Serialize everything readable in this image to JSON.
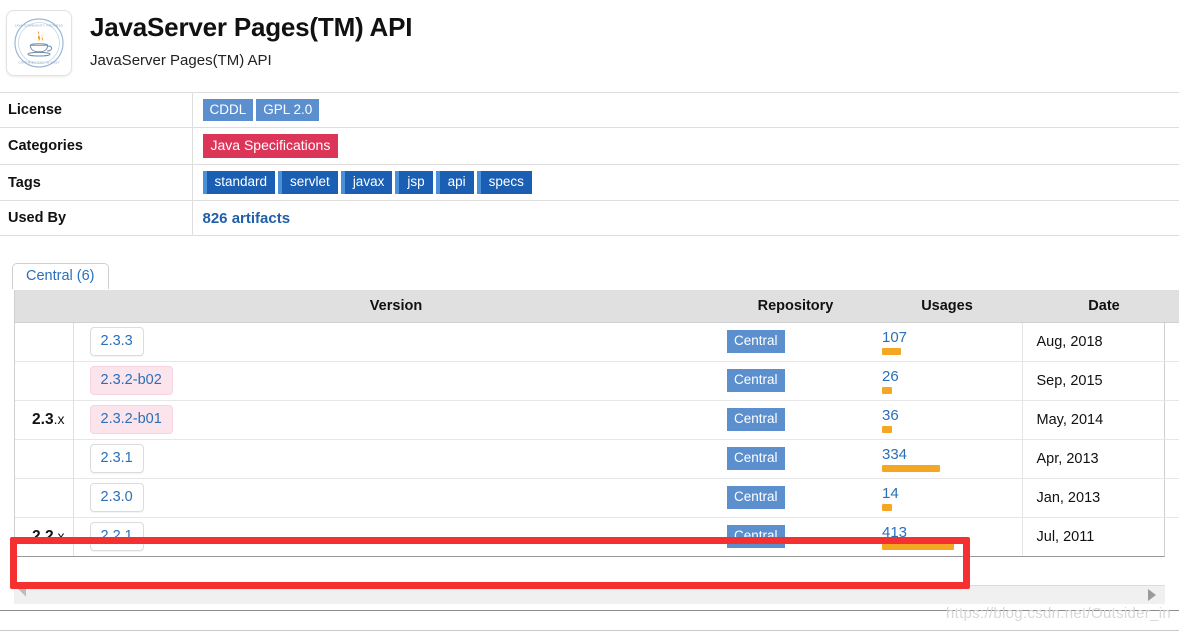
{
  "header": {
    "logo_icon": "java-community-process-seal-icon",
    "title": "JavaServer Pages(TM) API",
    "subtitle": "JavaServer Pages(TM) API"
  },
  "meta": {
    "rows": [
      {
        "label": "License",
        "type": "license",
        "values": [
          "CDDL",
          "GPL 2.0"
        ]
      },
      {
        "label": "Categories",
        "type": "category",
        "values": [
          "Java Specifications"
        ]
      },
      {
        "label": "Tags",
        "type": "tags",
        "values": [
          "standard",
          "servlet",
          "javax",
          "jsp",
          "api",
          "specs"
        ]
      },
      {
        "label": "Used By",
        "type": "link",
        "values": [
          "826 artifacts"
        ]
      }
    ],
    "labels": {
      "license": "License",
      "categories": "Categories",
      "tags": "Tags",
      "used_by": "Used By"
    },
    "license_badges": [
      "CDDL",
      "GPL 2.0"
    ],
    "category_badges": [
      "Java Specifications"
    ],
    "tag_badges": [
      "standard",
      "servlet",
      "javax",
      "jsp",
      "api",
      "specs"
    ],
    "used_by_link": "826 artifacts"
  },
  "tabs": [
    {
      "label": "Central (6)",
      "active": true
    }
  ],
  "versions_table": {
    "columns": [
      "",
      "Version",
      "Repository",
      "Usages",
      "Date"
    ],
    "headers": {
      "group": "",
      "version": "Version",
      "repository": "Repository",
      "usages": "Usages",
      "date": "Date"
    },
    "rows": [
      {
        "group": "",
        "group_bold": "",
        "group_suffix": "",
        "version": "2.3.3",
        "beta": false,
        "repository": "Central",
        "usages": "107",
        "usages_value": 107,
        "date": "Aug, 2018"
      },
      {
        "group": "",
        "group_bold": "",
        "group_suffix": "",
        "version": "2.3.2-b02",
        "beta": true,
        "repository": "Central",
        "usages": "26",
        "usages_value": 26,
        "date": "Sep, 2015"
      },
      {
        "group": "2.3.x",
        "group_bold": "2.3",
        "group_suffix": ".x",
        "version": "2.3.2-b01",
        "beta": true,
        "repository": "Central",
        "usages": "36",
        "usages_value": 36,
        "date": "May, 2014"
      },
      {
        "group": "",
        "group_bold": "",
        "group_suffix": "",
        "version": "2.3.1",
        "beta": false,
        "repository": "Central",
        "usages": "334",
        "usages_value": 334,
        "date": "Apr, 2013"
      },
      {
        "group": "",
        "group_bold": "",
        "group_suffix": "",
        "version": "2.3.0",
        "beta": false,
        "repository": "Central",
        "usages": "14",
        "usages_value": 14,
        "date": "Jan, 2013"
      },
      {
        "group": "2.2.x",
        "group_bold": "2.2",
        "group_suffix": ".x",
        "version": "2.2.1",
        "beta": false,
        "repository": "Central",
        "usages": "413",
        "usages_value": 413,
        "date": "Jul, 2011"
      }
    ]
  },
  "annotation": {
    "type": "red-highlight-rectangle",
    "target_row_version": "2.2.1"
  },
  "scrollbar": {
    "arrow_icon": "chevron-right-icon"
  },
  "watermark": "https://blog.csdn.net/Outsider_in",
  "colors": {
    "license_badge": "#5b8fce",
    "category_badge": "#dc3558",
    "tag_badge": "#1a5fb4",
    "tag_accent": "#4a90d9",
    "link_blue": "#2a6fb8",
    "usage_bar": "#f5a623",
    "annotation_red": "#f43030",
    "beta_badge_bg": "#fbe4ec",
    "header_bg": "#e0e0e0"
  }
}
